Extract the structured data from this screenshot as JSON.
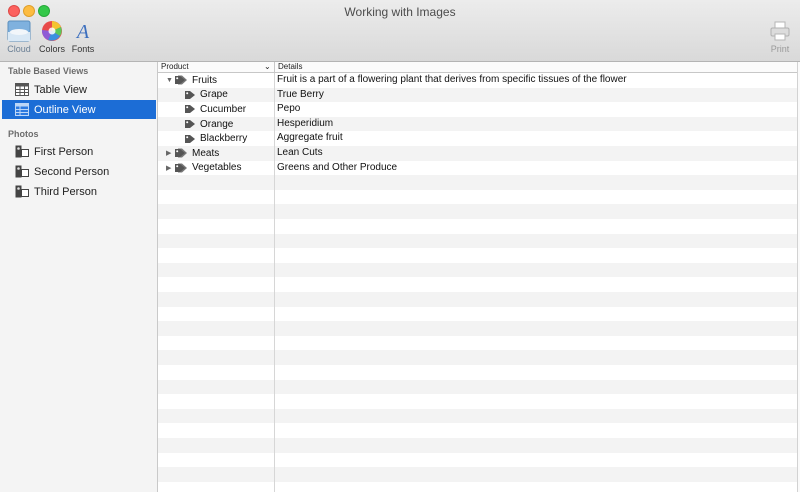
{
  "window": {
    "title": "Working with Images"
  },
  "toolbar": {
    "cloud_label": "Cloud",
    "colors_label": "Colors",
    "fonts_label": "Fonts",
    "print_label": "Print"
  },
  "sidebar": {
    "sections": [
      {
        "title": "Table Based Views",
        "items": [
          {
            "label": "Table View",
            "icon": "table-icon"
          },
          {
            "label": "Outline View",
            "icon": "outline-icon",
            "selected": true
          }
        ]
      },
      {
        "title": "Photos",
        "items": [
          {
            "label": "First Person",
            "icon": "person-photo-icon"
          },
          {
            "label": "Second Person",
            "icon": "person-photo-icon"
          },
          {
            "label": "Third Person",
            "icon": "person-photo-icon"
          }
        ]
      }
    ]
  },
  "outline": {
    "columns": {
      "product": "Product",
      "details": "Details"
    },
    "rows": [
      {
        "product": "Fruits",
        "details": "Fruit is a part of a flowering plant that derives from specific tissues of the flower",
        "level": 0,
        "disclosure": "expanded"
      },
      {
        "product": "Grape",
        "details": "True Berry",
        "level": 1
      },
      {
        "product": "Cucumber",
        "details": "Pepo",
        "level": 1
      },
      {
        "product": "Orange",
        "details": "Hesperidium",
        "level": 1
      },
      {
        "product": "Blackberry",
        "details": "Aggregate fruit",
        "level": 1
      },
      {
        "product": "Meats",
        "details": "Lean Cuts",
        "level": 0,
        "disclosure": "collapsed"
      },
      {
        "product": "Vegetables",
        "details": "Greens and Other Produce",
        "level": 0,
        "disclosure": "collapsed"
      }
    ]
  },
  "colors": {
    "selection": "#1c6dd6"
  }
}
